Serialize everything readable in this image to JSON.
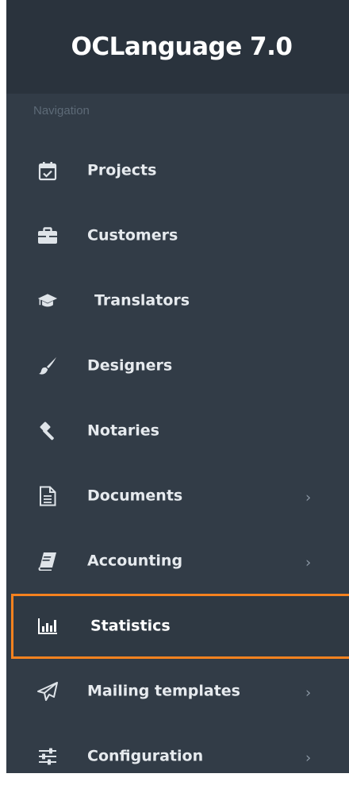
{
  "brand": {
    "title": "OCLanguage 7.0"
  },
  "navigation": {
    "section_label": "Navigation",
    "items": [
      {
        "label": "Projects",
        "icon": "calendar-check-icon",
        "has_submenu": false
      },
      {
        "label": "Customers",
        "icon": "briefcase-icon",
        "has_submenu": false
      },
      {
        "label": "Translators",
        "icon": "graduation-cap-icon",
        "has_submenu": false
      },
      {
        "label": "Designers",
        "icon": "paint-brush-icon",
        "has_submenu": false
      },
      {
        "label": "Notaries",
        "icon": "gavel-icon",
        "has_submenu": false
      },
      {
        "label": "Documents",
        "icon": "document-icon",
        "has_submenu": true
      },
      {
        "label": "Accounting",
        "icon": "book-icon",
        "has_submenu": true
      },
      {
        "label": "Statistics",
        "icon": "bar-chart-icon",
        "has_submenu": false,
        "active": true
      },
      {
        "label": "Mailing templates",
        "icon": "paper-plane-icon",
        "has_submenu": true
      },
      {
        "label": "Configuration",
        "icon": "sliders-icon",
        "has_submenu": true
      }
    ],
    "chevron": "›"
  },
  "colors": {
    "sidebar_bg": "#323c47",
    "brand_bg": "#2a333d",
    "active_border": "#f5821f",
    "text": "#e6eaee",
    "muted_text": "#5d6a77"
  }
}
